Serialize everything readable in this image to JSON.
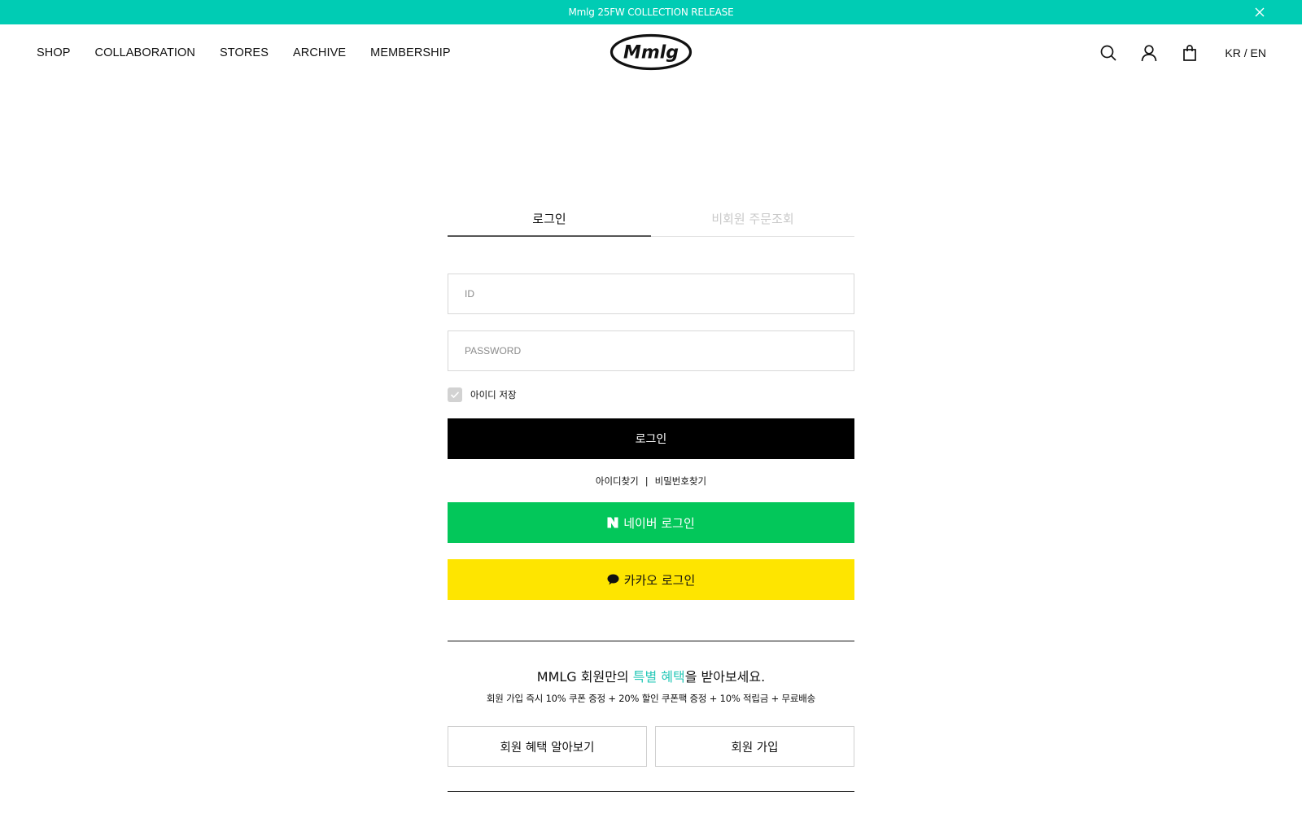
{
  "banner": {
    "text": "Mmlg 25FW COLLECTION RELEASE",
    "close_icon": "close-icon",
    "color": "#00ccb4"
  },
  "nav": {
    "items": [
      "SHOP",
      "COLLABORATION",
      "STORES",
      "ARCHIVE",
      "MEMBERSHIP"
    ]
  },
  "logo": {
    "text": "Mmlg"
  },
  "header_icons": {
    "search": "search-icon",
    "account": "user-icon",
    "cart": "shopping-bag-icon"
  },
  "language": {
    "label": "KR / EN"
  },
  "login": {
    "tabs": [
      {
        "label": "로그인",
        "active": true
      },
      {
        "label": "비회원 주문조회",
        "active": false
      }
    ],
    "id_placeholder": "ID",
    "password_placeholder": "PASSWORD",
    "save_id_label": "아이디 저장",
    "save_id_checked": true,
    "login_button": "로그인",
    "find_id": "아이디찾기",
    "find_separator": "|",
    "find_password": "비밀번호찾기",
    "naver_button": "네이버 로그인",
    "naver_color": "#03c75a",
    "kakao_button": "카카오 로그인",
    "kakao_color": "#fee500"
  },
  "benefits": {
    "title_prefix": "MMLG 회원만의 ",
    "title_highlight": "특별 혜택",
    "title_suffix": "을 받아보세요.",
    "highlight_color": "#28c8b8",
    "subtitle": "회원 가입 즉시 10% 쿠폰 증정 + 20% 할인 쿠폰팩 증정 + 10% 적립금 + 무료배송",
    "learn_more_button": "회원 혜택 알아보기",
    "signup_button": "회원 가입"
  }
}
